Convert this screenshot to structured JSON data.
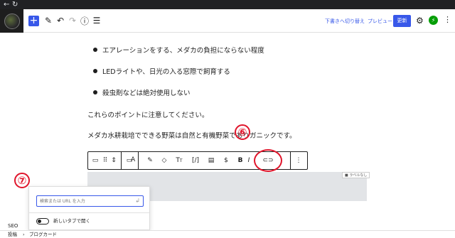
{
  "browser": {
    "back_icon": "back-arrow-icon",
    "reload_icon": "reload-icon"
  },
  "topbar": {
    "add_icon": "plus-icon",
    "tools": [
      "pencil-icon",
      "undo-icon",
      "redo-icon",
      "info-icon",
      "list-view-icon"
    ],
    "save_draft_label": "下書きへ切り替え",
    "preview_label": "プレビュー",
    "update_label": "更新",
    "settings_icon": "gear-icon",
    "jetpack_icon": "jetpack-icon",
    "options_icon": "vertical-ellipsis-icon",
    "accent_color": "#3858e9"
  },
  "content": {
    "bullets": [
      "エアレーションをする、メダカの負担にならない程度",
      "LEDライトや、日光の入る窓際で飼育する",
      "殺虫剤などは絶対使用しない"
    ],
    "paragraph1": "これらのポイントに注意してください。",
    "paragraph2_before": "メダカ水耕栽培でできる野菜は自然と有機野菜であり",
    "paragraph2_after": "ガニックです。"
  },
  "block_toolbar": {
    "items": [
      {
        "name": "block-type-icon",
        "glyph": "▭"
      },
      {
        "name": "drag-handle-icon",
        "glyph": "⠿"
      },
      {
        "name": "move-up-down-icon",
        "glyph": "⇕"
      },
      {
        "name": "align-icon",
        "glyph": "▭"
      },
      {
        "name": "font-icon",
        "glyph": "A"
      },
      {
        "name": "brush-icon",
        "glyph": "✎"
      },
      {
        "name": "tag-icon",
        "glyph": "◇"
      },
      {
        "name": "font-size-icon",
        "glyph": "Tt"
      },
      {
        "name": "shortcode-icon",
        "glyph": "[/]"
      },
      {
        "name": "document-icon",
        "glyph": "▤"
      },
      {
        "name": "dollar-icon",
        "glyph": "$"
      },
      {
        "name": "bold-icon",
        "glyph": "B"
      },
      {
        "name": "italic-icon",
        "glyph": "I"
      },
      {
        "name": "link-icon",
        "glyph": "⊂⊃"
      },
      {
        "name": "more-options-icon",
        "glyph": "⋮"
      }
    ]
  },
  "label_badge": "■ ラベルなし",
  "link_popover": {
    "placeholder": "検索または URL を入力",
    "enter_icon": "enter-icon",
    "new_tab_label": "新しいタブで開く"
  },
  "annotations": {
    "six": "⑥",
    "seven": "⑦",
    "color": "#e0152b"
  },
  "seo_label": "SEO",
  "footer": {
    "breadcrumb_root": "投稿",
    "separator": "›",
    "breadcrumb_current": "ブログカード"
  }
}
